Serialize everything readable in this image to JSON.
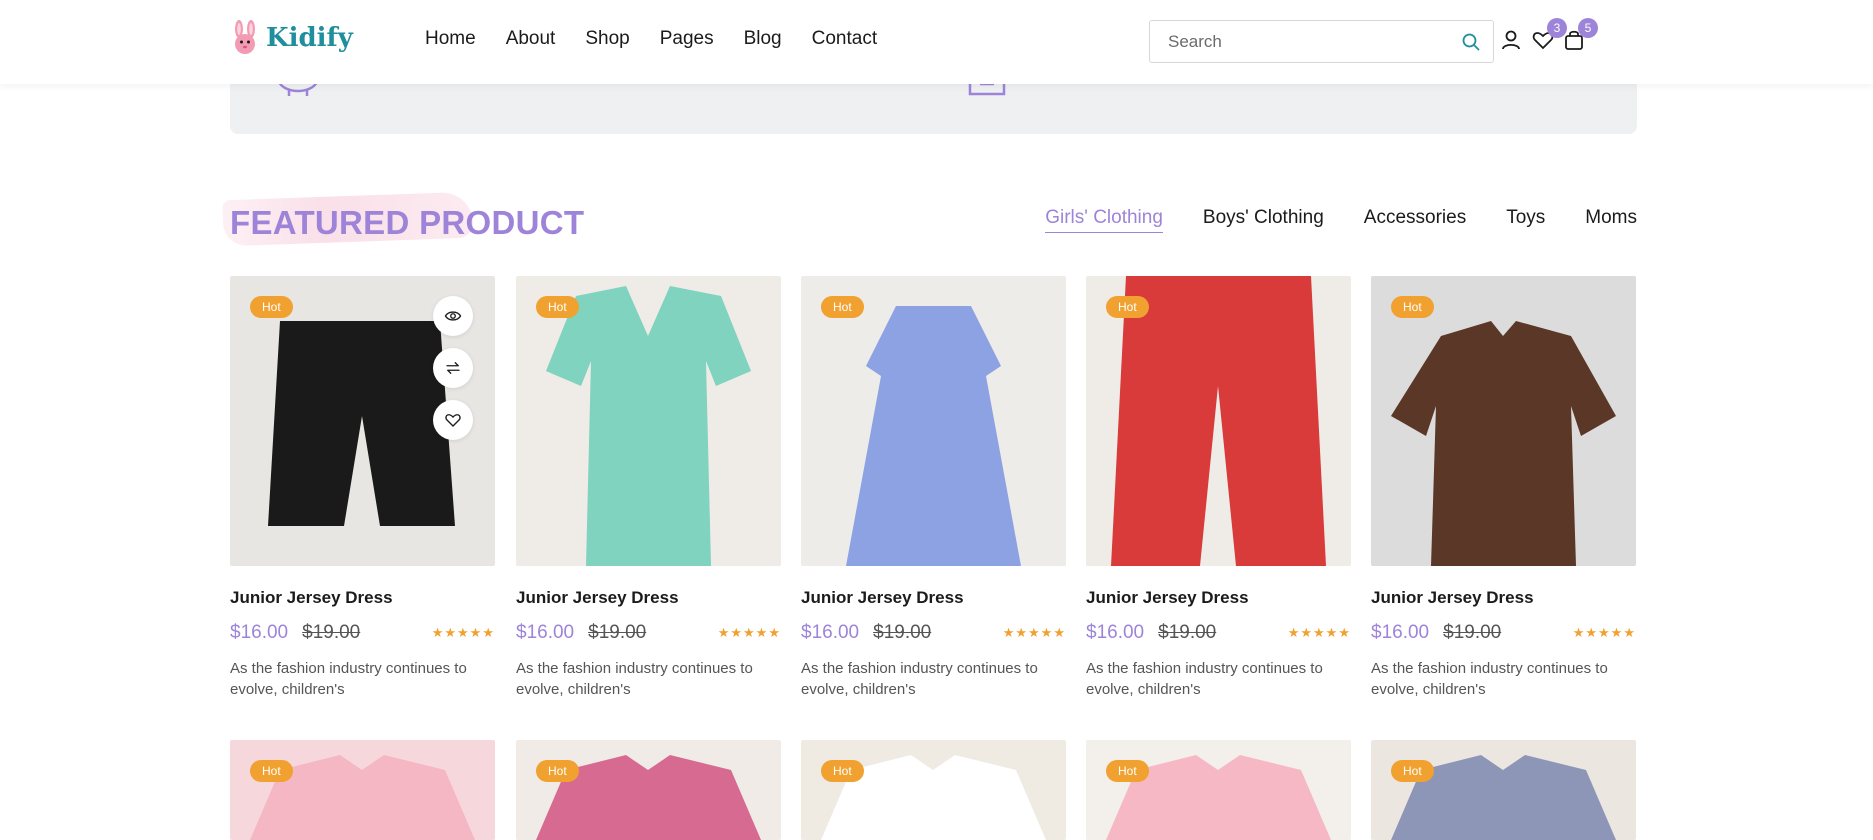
{
  "brand": {
    "name": "Kidify"
  },
  "nav": {
    "items": [
      "Home",
      "About",
      "Shop",
      "Pages",
      "Blog",
      "Contact"
    ]
  },
  "search": {
    "placeholder": "Search"
  },
  "header_icons": {
    "wishlist_count": "3",
    "cart_count": "5"
  },
  "section": {
    "title": "FEATURED PRODUCT",
    "tabs": [
      "Girls' Clothing",
      "Boys' Clothing",
      "Accessories",
      "Toys",
      "Moms"
    ],
    "active_tab": "Girls' Clothing"
  },
  "badge_label": "Hot",
  "products": [
    {
      "name": "Junior Jersey Dress",
      "price": "$16.00",
      "old_price": "$19.00",
      "rating": 5,
      "desc": "As the fashion industry continues to evolve, children's",
      "img_color": "#e8e6e2",
      "item_color": "#1a1a1a",
      "item_type": "shorts"
    },
    {
      "name": "Junior Jersey Dress",
      "price": "$16.00",
      "old_price": "$19.00",
      "rating": 5,
      "desc": "As the fashion industry continues to evolve, children's",
      "img_color": "#efebe6",
      "item_color": "#7fd3bf",
      "item_type": "romper"
    },
    {
      "name": "Junior Jersey Dress",
      "price": "$16.00",
      "old_price": "$19.00",
      "rating": 5,
      "desc": "As the fashion industry continues to evolve, children's",
      "img_color": "#eeece9",
      "item_color": "#8da2e3",
      "item_type": "dress"
    },
    {
      "name": "Junior Jersey Dress",
      "price": "$16.00",
      "old_price": "$19.00",
      "rating": 5,
      "desc": "As the fashion industry continues to evolve, children's",
      "img_color": "#efece7",
      "item_color": "#d93a3a",
      "item_type": "pants"
    },
    {
      "name": "Junior Jersey Dress",
      "price": "$16.00",
      "old_price": "$19.00",
      "rating": 5,
      "desc": "As the fashion industry continues to evolve, children's",
      "img_color": "#dcdcdc",
      "item_color": "#5a3726",
      "item_type": "tshirt"
    }
  ],
  "row2": [
    {
      "img_color": "#f6d7dc",
      "item_color": "#f4b7c3"
    },
    {
      "img_color": "#f1ebe7",
      "item_color": "#d66a90"
    },
    {
      "img_color": "#efeae2",
      "item_color": "#ffffff"
    },
    {
      "img_color": "#f3efea",
      "item_color": "#f6b8c5"
    },
    {
      "img_color": "#ece6e1",
      "item_color": "#8e96b8"
    }
  ],
  "colors": {
    "accent": "#9e84d9",
    "badge": "#f0a130",
    "logo_text": "#1f8f9e"
  }
}
